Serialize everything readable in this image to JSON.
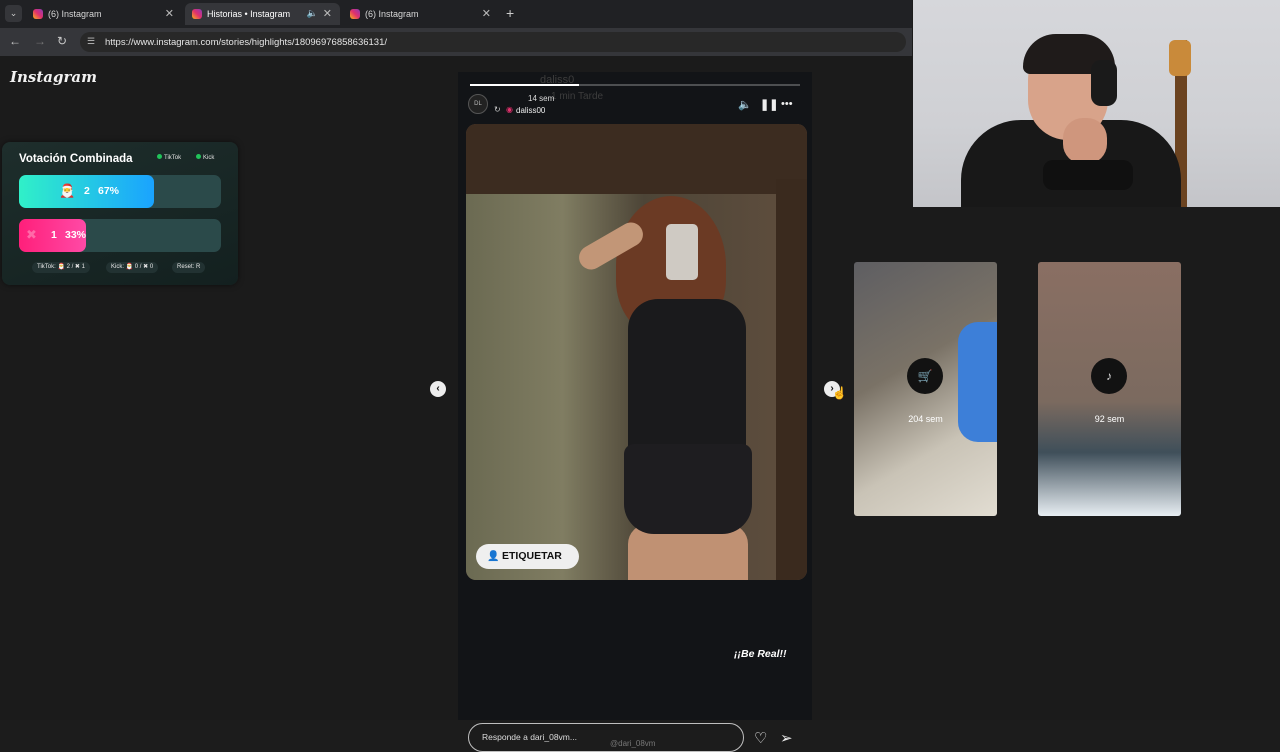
{
  "browser": {
    "tabs": [
      {
        "title": "(6) Instagram",
        "active": false
      },
      {
        "title": "Historias • Instagram",
        "active": true
      },
      {
        "title": "(6) Instagram",
        "active": false
      }
    ],
    "new_tab": "+",
    "url": "https://www.instagram.com/stories/highlights/18096976858636131/"
  },
  "instagram": {
    "logo": "Instagram"
  },
  "vote_widget": {
    "title": "Votación Combinada",
    "chips": [
      "TikTok",
      "Kick"
    ],
    "options": [
      {
        "count": "2",
        "percent": "67%",
        "share": 0.67,
        "icon": "santa-icon",
        "color": "#2ee6c0"
      },
      {
        "count": "1",
        "percent": "33%",
        "share": 0.33,
        "icon": "x-mark-icon",
        "color": "#ff1f7a"
      }
    ],
    "footer": {
      "tiktok": "TikTok: 🎅 2 / ✖ 1",
      "kick": "Kick: 🎅 0 / ✖ 0",
      "reset": "Reset: R"
    }
  },
  "story": {
    "ghost_username": "daliss0",
    "ghost_time": "1 min  Tarde",
    "time": "14 sem",
    "username": "daliss00",
    "avatar_text": "DL",
    "progress": 0.33,
    "tag_button": "ETIQUETAR",
    "caption": "¡¡Be Real!!",
    "reply_placeholder": "Responde a dari_08vm...",
    "mention": "@dari_08vm"
  },
  "side_stories": [
    {
      "time": "204 sem",
      "icon": "cart-icon"
    },
    {
      "time": "92 sem",
      "icon": "music-icon"
    }
  ]
}
